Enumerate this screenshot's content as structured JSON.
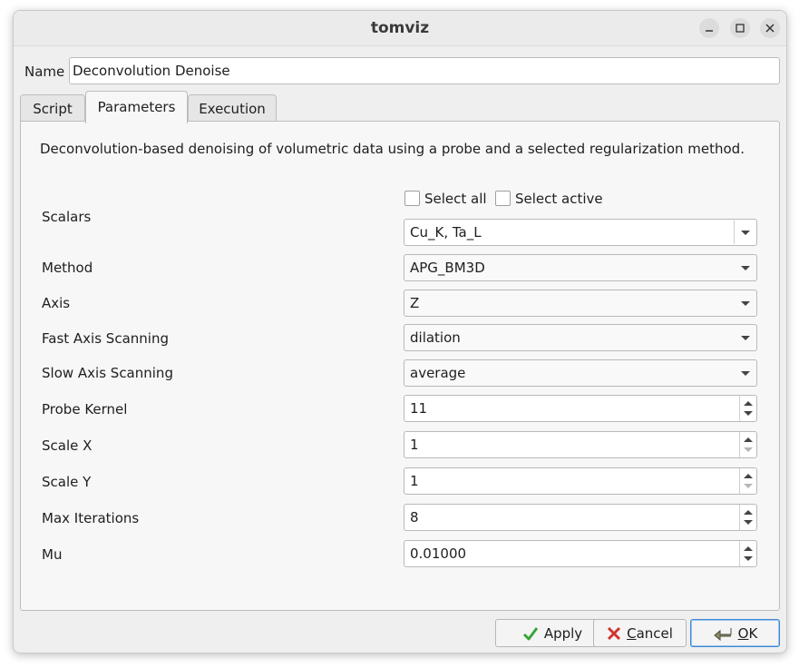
{
  "window": {
    "title": "tomviz"
  },
  "name_field": {
    "label": "Name",
    "value": "Deconvolution Denoise"
  },
  "tabs": [
    {
      "label": "Script"
    },
    {
      "label": "Parameters"
    },
    {
      "label": "Execution"
    }
  ],
  "parameters": {
    "description": "Deconvolution-based denoising of volumetric data using a probe and a selected regularization method.",
    "select_all_label": "Select all",
    "select_active_label": "Select active",
    "rows": [
      {
        "label": "Scalars",
        "value": "Cu_K, Ta_L",
        "control": "combo"
      },
      {
        "label": "Method",
        "value": "APG_BM3D",
        "control": "combo"
      },
      {
        "label": "Axis",
        "value": "Z",
        "control": "combo"
      },
      {
        "label": "Fast Axis Scanning",
        "value": "dilation",
        "control": "combo"
      },
      {
        "label": "Slow Axis Scanning",
        "value": "average",
        "control": "combo"
      },
      {
        "label": "Probe Kernel",
        "value": "11",
        "control": "spinbox"
      },
      {
        "label": "Scale X",
        "value": "1",
        "control": "spinbox"
      },
      {
        "label": "Scale Y",
        "value": "1",
        "control": "spinbox"
      },
      {
        "label": "Max Iterations",
        "value": "8",
        "control": "spinbox"
      },
      {
        "label": "Mu",
        "value": "0.01000",
        "control": "spinbox"
      }
    ]
  },
  "buttons": {
    "apply": {
      "label": "Apply",
      "icon": "check-icon"
    },
    "cancel": {
      "label_mnemonic": "C",
      "label_rest": "ancel",
      "icon": "cross-icon"
    },
    "ok": {
      "label_mnemonic": "O",
      "label_rest": "K",
      "icon": "ok-arrow-icon"
    }
  },
  "colors": {
    "accent": "#3d87d4",
    "apply_check": "#3aa53a",
    "cancel_cross": "#d0342c"
  }
}
